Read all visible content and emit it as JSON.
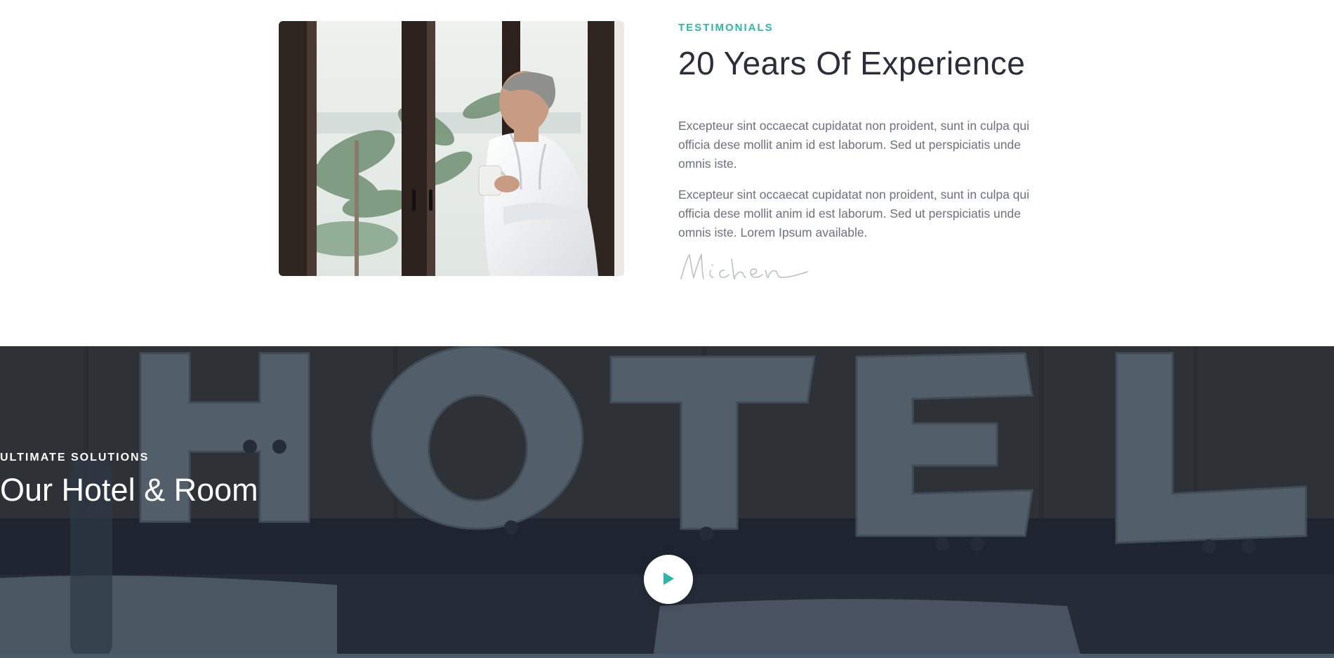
{
  "testimonials": {
    "eyebrow": "Testimonials",
    "title": "20 Years Of Experience",
    "paragraphs": [
      "Excepteur sint occaecat cupidatat non proident, sunt in culpa qui officia dese mollit anim id est laborum. Sed ut perspiciatis unde omnis iste.",
      "Excepteur sint occaecat cupidatat non proident, sunt in culpa qui officia dese mollit anim id est laborum. Sed ut perspiciatis unde omnis iste. Lorem Ipsum available."
    ],
    "signature": "Michen"
  },
  "hotel_banner": {
    "eyebrow": "Ultimate Solutions",
    "title": "Our Hotel & Room",
    "sign_letters": "HOTEL",
    "play_icon": "play-icon"
  },
  "colors": {
    "accent": "#2db7a6",
    "heading": "#2a2d3a",
    "body_text": "#6d7180",
    "banner_overlay": "#24303f"
  }
}
